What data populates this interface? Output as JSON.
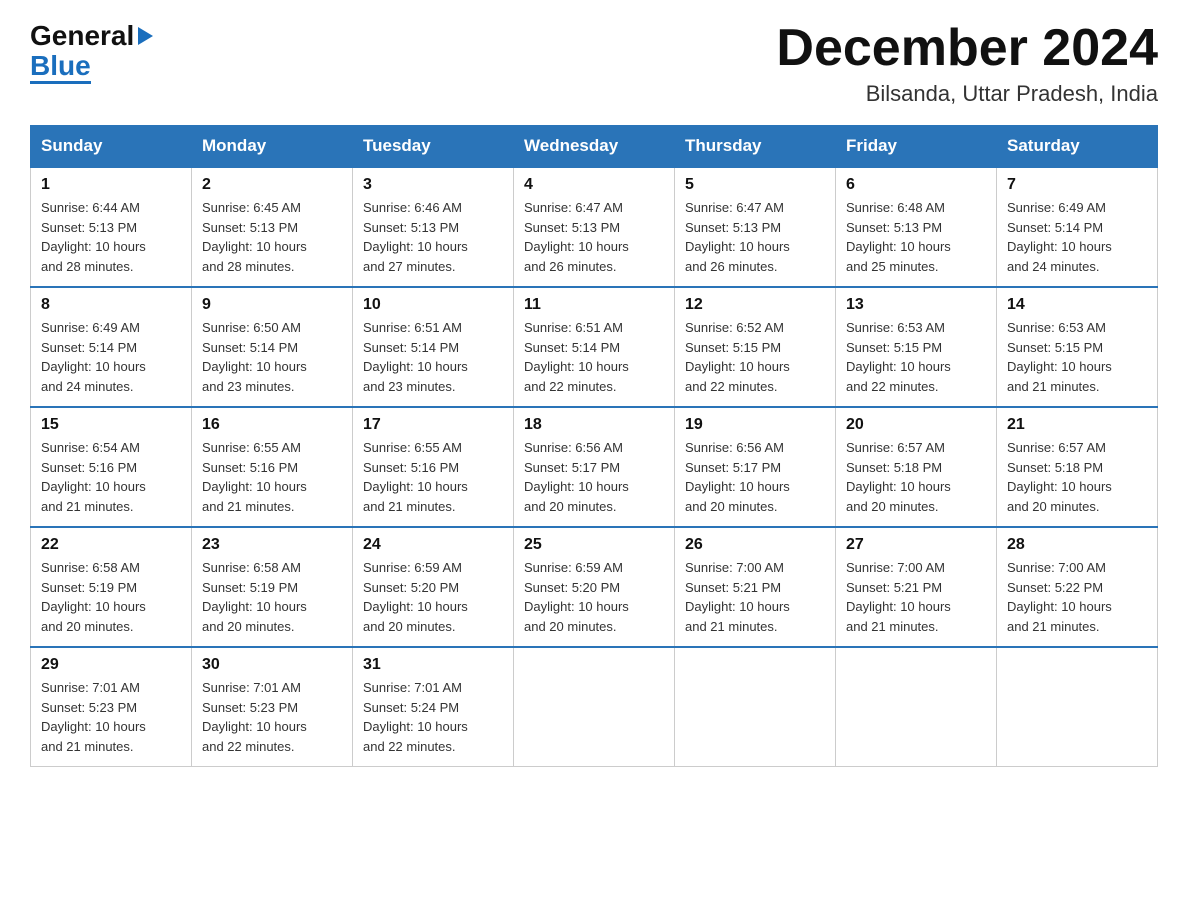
{
  "logo": {
    "general": "General",
    "triangle": "▶",
    "blue": "Blue"
  },
  "header": {
    "title": "December 2024",
    "subtitle": "Bilsanda, Uttar Pradesh, India"
  },
  "calendar": {
    "days_of_week": [
      "Sunday",
      "Monday",
      "Tuesday",
      "Wednesday",
      "Thursday",
      "Friday",
      "Saturday"
    ],
    "weeks": [
      {
        "days": [
          {
            "num": "1",
            "info": "Sunrise: 6:44 AM\nSunset: 5:13 PM\nDaylight: 10 hours\nand 28 minutes."
          },
          {
            "num": "2",
            "info": "Sunrise: 6:45 AM\nSunset: 5:13 PM\nDaylight: 10 hours\nand 28 minutes."
          },
          {
            "num": "3",
            "info": "Sunrise: 6:46 AM\nSunset: 5:13 PM\nDaylight: 10 hours\nand 27 minutes."
          },
          {
            "num": "4",
            "info": "Sunrise: 6:47 AM\nSunset: 5:13 PM\nDaylight: 10 hours\nand 26 minutes."
          },
          {
            "num": "5",
            "info": "Sunrise: 6:47 AM\nSunset: 5:13 PM\nDaylight: 10 hours\nand 26 minutes."
          },
          {
            "num": "6",
            "info": "Sunrise: 6:48 AM\nSunset: 5:13 PM\nDaylight: 10 hours\nand 25 minutes."
          },
          {
            "num": "7",
            "info": "Sunrise: 6:49 AM\nSunset: 5:14 PM\nDaylight: 10 hours\nand 24 minutes."
          }
        ]
      },
      {
        "days": [
          {
            "num": "8",
            "info": "Sunrise: 6:49 AM\nSunset: 5:14 PM\nDaylight: 10 hours\nand 24 minutes."
          },
          {
            "num": "9",
            "info": "Sunrise: 6:50 AM\nSunset: 5:14 PM\nDaylight: 10 hours\nand 23 minutes."
          },
          {
            "num": "10",
            "info": "Sunrise: 6:51 AM\nSunset: 5:14 PM\nDaylight: 10 hours\nand 23 minutes."
          },
          {
            "num": "11",
            "info": "Sunrise: 6:51 AM\nSunset: 5:14 PM\nDaylight: 10 hours\nand 22 minutes."
          },
          {
            "num": "12",
            "info": "Sunrise: 6:52 AM\nSunset: 5:15 PM\nDaylight: 10 hours\nand 22 minutes."
          },
          {
            "num": "13",
            "info": "Sunrise: 6:53 AM\nSunset: 5:15 PM\nDaylight: 10 hours\nand 22 minutes."
          },
          {
            "num": "14",
            "info": "Sunrise: 6:53 AM\nSunset: 5:15 PM\nDaylight: 10 hours\nand 21 minutes."
          }
        ]
      },
      {
        "days": [
          {
            "num": "15",
            "info": "Sunrise: 6:54 AM\nSunset: 5:16 PM\nDaylight: 10 hours\nand 21 minutes."
          },
          {
            "num": "16",
            "info": "Sunrise: 6:55 AM\nSunset: 5:16 PM\nDaylight: 10 hours\nand 21 minutes."
          },
          {
            "num": "17",
            "info": "Sunrise: 6:55 AM\nSunset: 5:16 PM\nDaylight: 10 hours\nand 21 minutes."
          },
          {
            "num": "18",
            "info": "Sunrise: 6:56 AM\nSunset: 5:17 PM\nDaylight: 10 hours\nand 20 minutes."
          },
          {
            "num": "19",
            "info": "Sunrise: 6:56 AM\nSunset: 5:17 PM\nDaylight: 10 hours\nand 20 minutes."
          },
          {
            "num": "20",
            "info": "Sunrise: 6:57 AM\nSunset: 5:18 PM\nDaylight: 10 hours\nand 20 minutes."
          },
          {
            "num": "21",
            "info": "Sunrise: 6:57 AM\nSunset: 5:18 PM\nDaylight: 10 hours\nand 20 minutes."
          }
        ]
      },
      {
        "days": [
          {
            "num": "22",
            "info": "Sunrise: 6:58 AM\nSunset: 5:19 PM\nDaylight: 10 hours\nand 20 minutes."
          },
          {
            "num": "23",
            "info": "Sunrise: 6:58 AM\nSunset: 5:19 PM\nDaylight: 10 hours\nand 20 minutes."
          },
          {
            "num": "24",
            "info": "Sunrise: 6:59 AM\nSunset: 5:20 PM\nDaylight: 10 hours\nand 20 minutes."
          },
          {
            "num": "25",
            "info": "Sunrise: 6:59 AM\nSunset: 5:20 PM\nDaylight: 10 hours\nand 20 minutes."
          },
          {
            "num": "26",
            "info": "Sunrise: 7:00 AM\nSunset: 5:21 PM\nDaylight: 10 hours\nand 21 minutes."
          },
          {
            "num": "27",
            "info": "Sunrise: 7:00 AM\nSunset: 5:21 PM\nDaylight: 10 hours\nand 21 minutes."
          },
          {
            "num": "28",
            "info": "Sunrise: 7:00 AM\nSunset: 5:22 PM\nDaylight: 10 hours\nand 21 minutes."
          }
        ]
      },
      {
        "days": [
          {
            "num": "29",
            "info": "Sunrise: 7:01 AM\nSunset: 5:23 PM\nDaylight: 10 hours\nand 21 minutes."
          },
          {
            "num": "30",
            "info": "Sunrise: 7:01 AM\nSunset: 5:23 PM\nDaylight: 10 hours\nand 22 minutes."
          },
          {
            "num": "31",
            "info": "Sunrise: 7:01 AM\nSunset: 5:24 PM\nDaylight: 10 hours\nand 22 minutes."
          },
          null,
          null,
          null,
          null
        ]
      }
    ]
  }
}
